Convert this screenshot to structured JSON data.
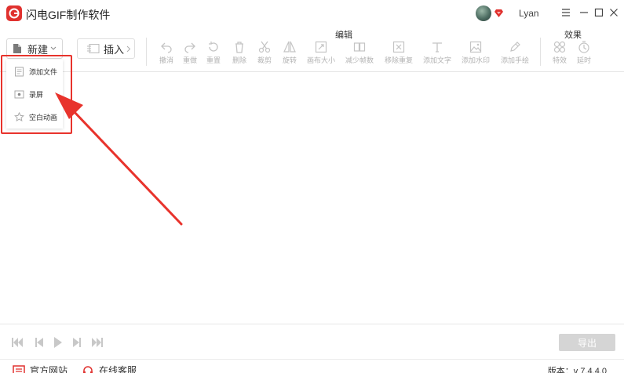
{
  "app": {
    "title": "闪电GIF制作软件",
    "username": "Lyan",
    "accent": "#e0312e"
  },
  "toolbar": {
    "new_label": "新建",
    "insert_label": "插入",
    "edit_group_label": "编辑",
    "effect_group_label": "效果",
    "edit_tools": [
      {
        "label": "撤消",
        "icon": "undo-icon"
      },
      {
        "label": "重做",
        "icon": "redo-icon"
      },
      {
        "label": "重置",
        "icon": "reset-icon"
      },
      {
        "label": "删除",
        "icon": "delete-icon"
      },
      {
        "label": "裁剪",
        "icon": "scissors-icon"
      },
      {
        "label": "旋转",
        "icon": "rotate-icon"
      },
      {
        "label": "画布大小",
        "icon": "canvas-size-icon"
      },
      {
        "label": "减少帧数",
        "icon": "reduce-frames-icon"
      },
      {
        "label": "移除重复",
        "icon": "remove-duplicate-icon"
      },
      {
        "label": "添加文字",
        "icon": "text-icon"
      },
      {
        "label": "添加水印",
        "icon": "watermark-icon"
      },
      {
        "label": "添加手绘",
        "icon": "pen-icon"
      }
    ],
    "effect_tools": [
      {
        "label": "特效",
        "icon": "effects-icon"
      },
      {
        "label": "延时",
        "icon": "timer-icon"
      }
    ]
  },
  "new_menu": {
    "items": [
      {
        "label": "添加文件",
        "icon": "file-icon"
      },
      {
        "label": "录屏",
        "icon": "record-screen-icon"
      },
      {
        "label": "空白动画",
        "icon": "star-icon"
      }
    ]
  },
  "player": {
    "export_label": "导出"
  },
  "status": {
    "website": "官方网站",
    "support": "在线客服",
    "version": "版本：v 7.4.4.0"
  }
}
